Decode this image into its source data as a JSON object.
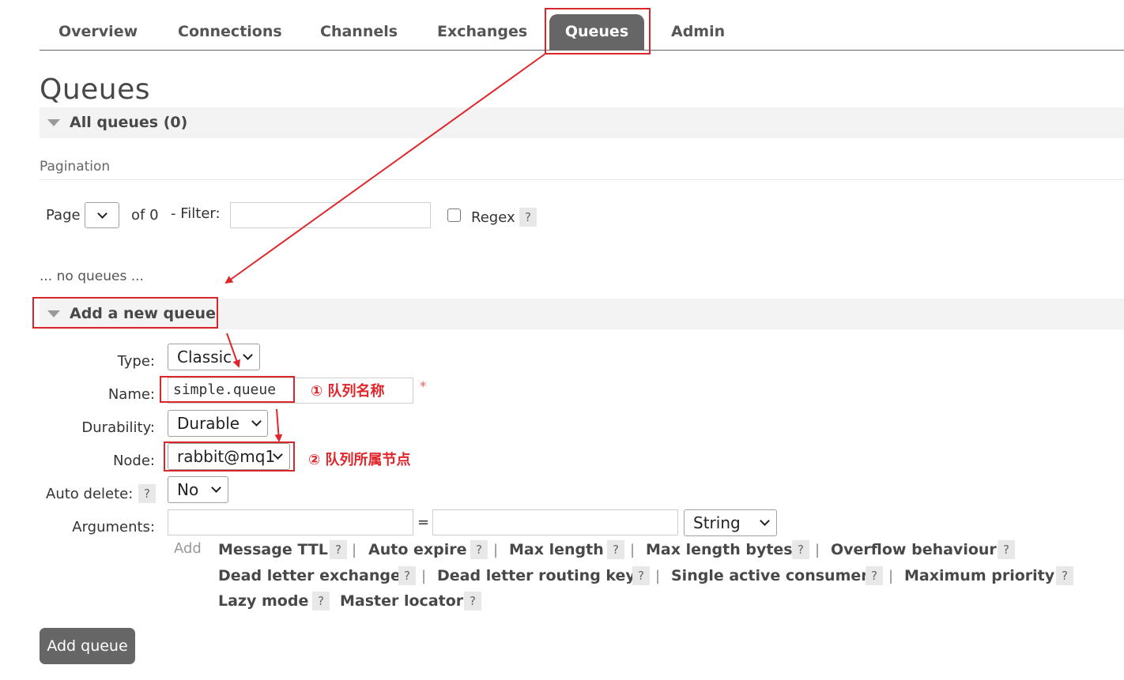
{
  "nav": {
    "tabs": [
      "Overview",
      "Connections",
      "Channels",
      "Exchanges",
      "Queues",
      "Admin"
    ],
    "active": "Queues"
  },
  "page": {
    "title": "Queues"
  },
  "all_queues": {
    "header": "All queues (0)",
    "pagination_heading": "Pagination",
    "page_label": "Page",
    "of_label": "of 0",
    "filter_label": "- Filter:",
    "filter_value": "",
    "regex_label": "Regex",
    "help": "?",
    "empty_text": "... no queues ..."
  },
  "add_queue": {
    "header": "Add a new queue",
    "type_label": "Type:",
    "type_value": "Classic",
    "name_label": "Name:",
    "name_value": "simple.queue",
    "required_mark": "*",
    "durability_label": "Durability:",
    "durability_value": "Durable",
    "node_label": "Node:",
    "node_value": "rabbit@mq1",
    "auto_delete_label": "Auto delete:",
    "auto_delete_value": "No",
    "arguments_label": "Arguments:",
    "equals": "=",
    "arg_type_value": "String",
    "add_label": "Add",
    "help": "?",
    "separator": "|",
    "argument_shortcuts": [
      "Message TTL",
      "Auto expire",
      "Max length",
      "Max length bytes",
      "Overflow behaviour",
      "Dead letter exchange",
      "Dead letter routing key",
      "Single active consumer",
      "Maximum priority",
      "Lazy mode",
      "Master locator"
    ],
    "submit_label": "Add queue"
  },
  "annotations": {
    "name_note": "① 队列名称",
    "node_note": "② 队列所属节点",
    "color": "#e0262b"
  }
}
